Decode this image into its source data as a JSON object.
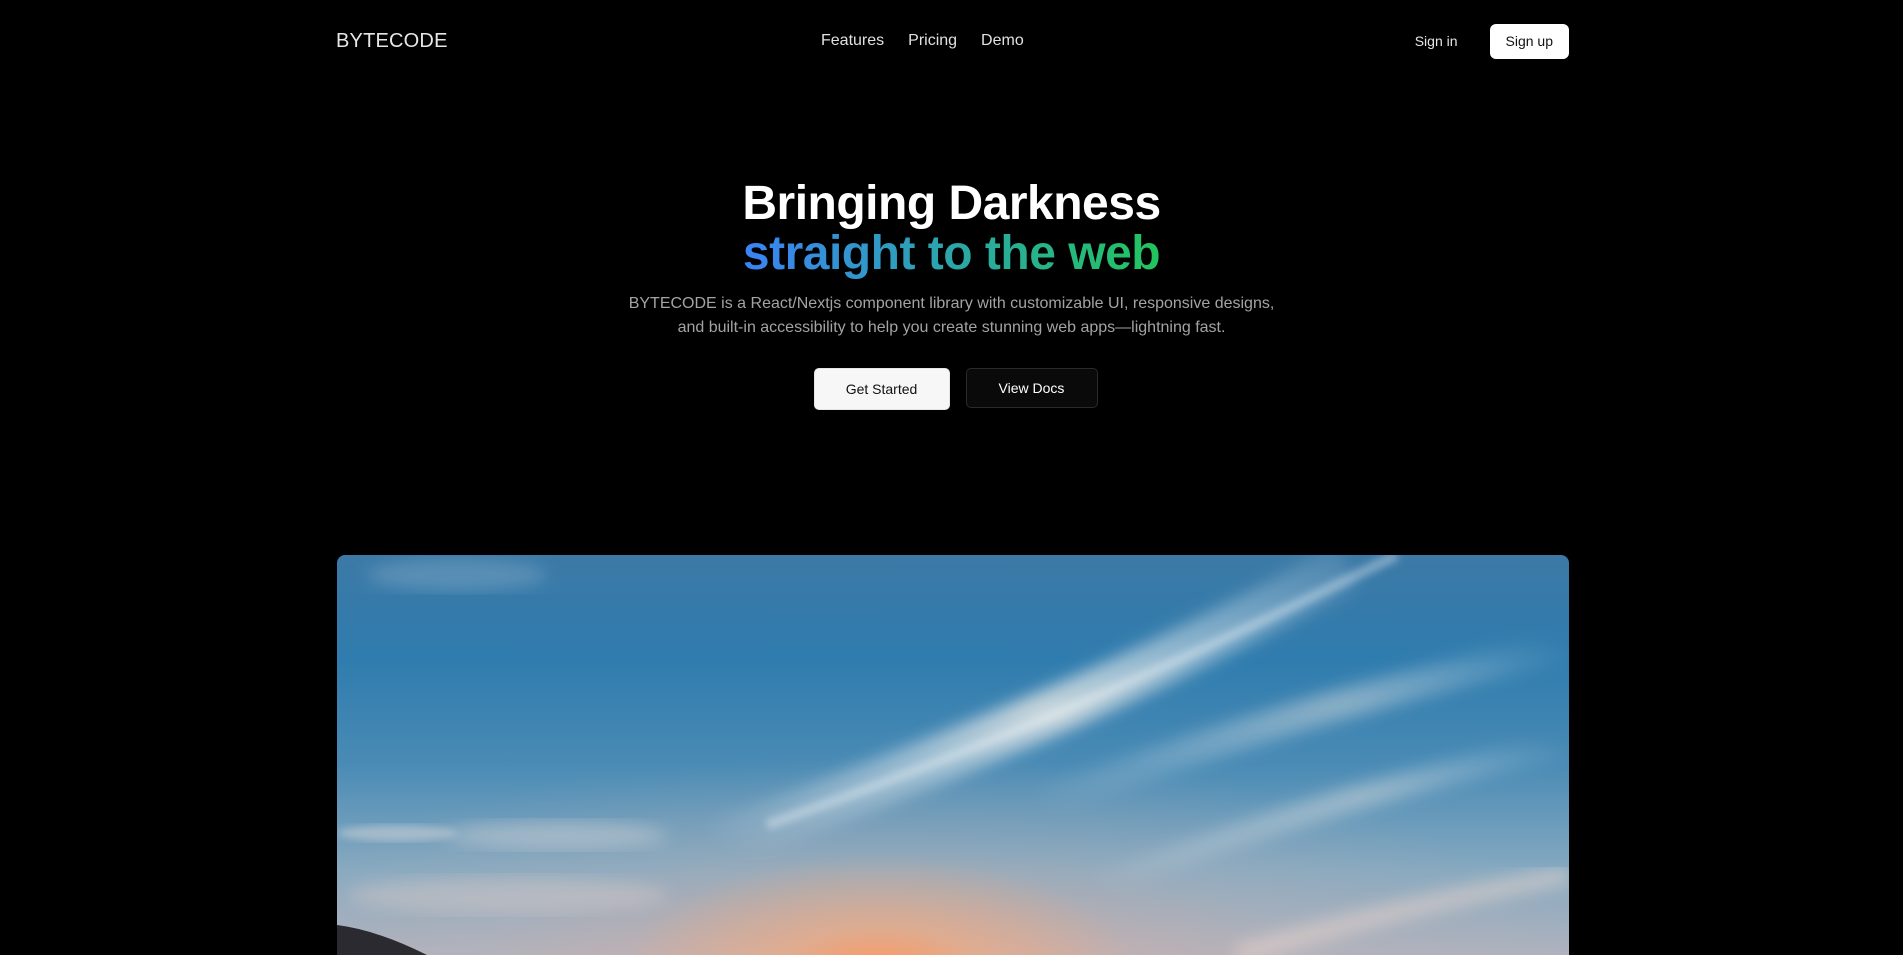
{
  "nav": {
    "brand": "BYTECODE",
    "links": [
      "Features",
      "Pricing",
      "Demo"
    ],
    "signin_label": "Sign in",
    "signup_label": "Sign up"
  },
  "hero": {
    "title_line1": "Bringing Darkness",
    "title_line2": "straight to the web",
    "description_line1": "BYTECODE is a React/Nextjs component library with customizable UI, responsive designs,",
    "description_line2": "and built-in accessibility to help you create stunning web apps—lightning fast.",
    "primary_button": "Get Started",
    "secondary_button": "View Docs"
  },
  "colors": {
    "background": "#000000",
    "gradient_start": "#3b82f6",
    "gradient_mid": "#2ba6a9",
    "gradient_end": "#22c55e"
  },
  "image": {
    "subject": "sunset-sky-photo"
  }
}
